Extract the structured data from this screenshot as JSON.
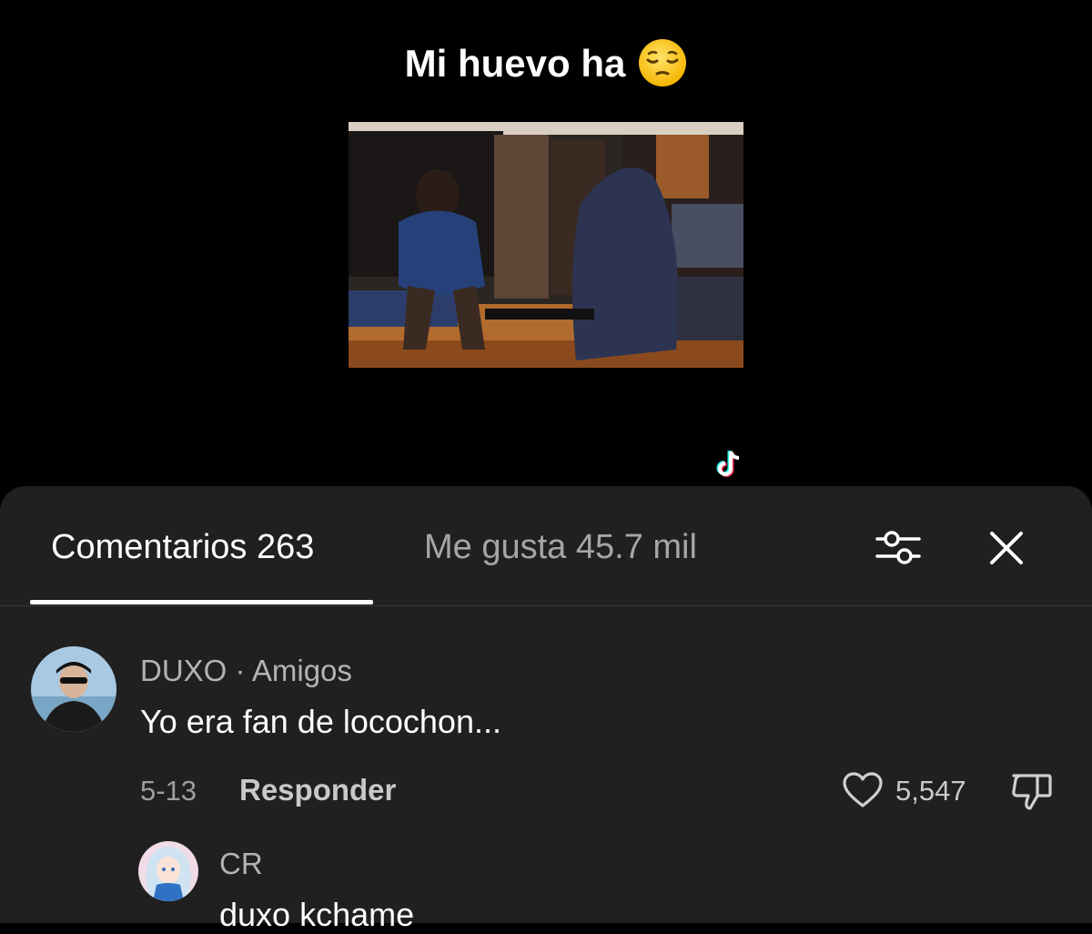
{
  "video": {
    "caption": "Mi huevo ha",
    "caption_emoji": "pensive-face-emoji"
  },
  "tabs": [
    {
      "label": "Comentarios 263",
      "active": true
    },
    {
      "label": "Me gusta 45.7 mil",
      "active": false
    }
  ],
  "icons": {
    "filter": "sliders-icon",
    "close": "close-icon",
    "like": "heart-icon",
    "dislike": "thumbs-down-icon"
  },
  "comments": [
    {
      "username": "DUXO",
      "separator": " · ",
      "relation": "Amigos",
      "text": "Yo era fan de locochon...",
      "date": "5-13",
      "reply_label": "Responder",
      "likes": "5,547"
    }
  ],
  "replies": [
    {
      "username": "CR",
      "text": "duxo kchame"
    }
  ],
  "colors": {
    "background": "#000000",
    "sheet": "#202020",
    "text_primary": "#ffffff",
    "text_secondary": "#a6a6a6"
  }
}
